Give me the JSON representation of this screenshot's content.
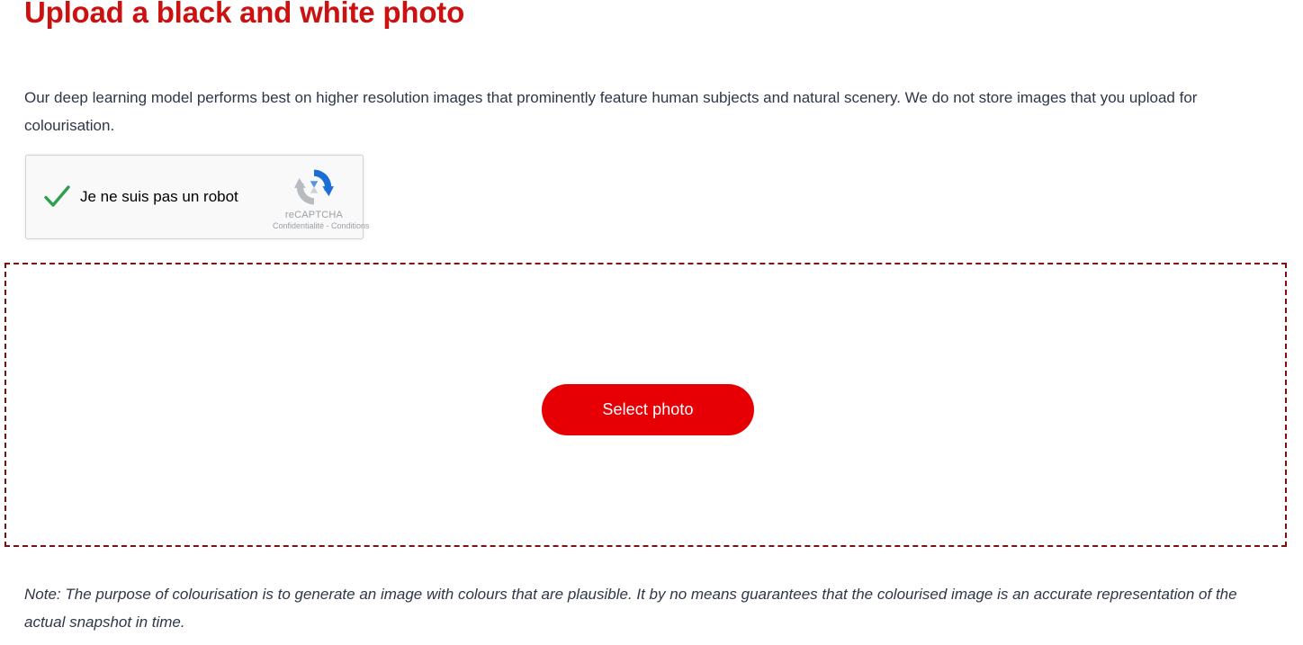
{
  "page": {
    "title": "Upload a black and white photo",
    "intro": "Our deep learning model performs best on higher resolution images that prominently feature human subjects and natural scenery. We do not store images that you upload for colourisation.",
    "note": "Note: The purpose of colourisation is to generate an image with colours that are plausible. It by no means guarantees that the colourised image is an accurate representation of the actual snapshot in time."
  },
  "recaptcha": {
    "checkbox_label": "Je ne suis pas un robot",
    "checked": true,
    "brand_name": "reCAPTCHA",
    "privacy_label": "Confidentialité",
    "separator": "-",
    "terms_label": "Conditions",
    "links_line": "Confidentialité - Conditions",
    "check_icon": "green-check-icon",
    "logo_icon": "recaptcha-logo-icon"
  },
  "dropzone": {
    "button_label": "Select photo",
    "border_style": "dashed"
  },
  "colors": {
    "title_red": "#cc1111",
    "button_red": "#e60005",
    "dropzone_border": "#7b1113",
    "body_text": "#2d3748",
    "check_green": "#2e9e4f",
    "recaptcha_bg": "#f9f9f9",
    "recaptcha_border": "#d3d3d3",
    "recaptcha_muted": "#9aa0a6",
    "logo_blue": "#1c6ed4",
    "logo_gray": "#9aa0a6"
  }
}
